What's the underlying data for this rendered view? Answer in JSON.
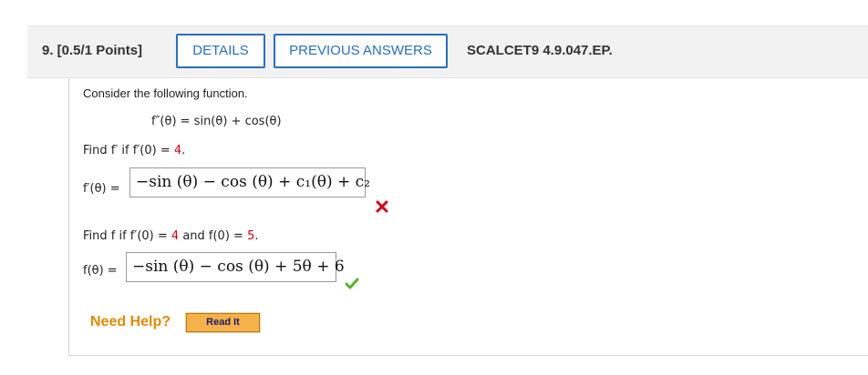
{
  "header": {
    "question_label": "9. [0.5/1 Points]",
    "details_button": "DETAILS",
    "previous_answers_button": "PREVIOUS ANSWERS",
    "problem_id": "SCALCET9 4.9.047.EP."
  },
  "problem": {
    "intro": "Consider the following function.",
    "function": "f″(θ) = sin(θ) + cos(θ)",
    "part1": {
      "prompt_prefix": "Find f′ if f′(0) = ",
      "prompt_value": "4",
      "prompt_suffix": ".",
      "answer_label": "f′(θ) =",
      "answer_value": "−sin (θ) − cos (θ) + c₁(θ) + c₂",
      "status": "incorrect",
      "status_icon": "x-icon",
      "status_color": "#d0021b"
    },
    "part2": {
      "prompt_a": "Find f if f′(0) = ",
      "prompt_value1": "4",
      "prompt_b": " and f(0) = ",
      "prompt_value2": "5",
      "prompt_suffix": ".",
      "answer_label": "f(θ) =",
      "answer_value": "−sin (θ) − cos (θ) + 5θ + 6",
      "status": "correct",
      "status_icon": "checkmark-icon",
      "status_color": "#5ab030"
    }
  },
  "help": {
    "label": "Need Help?",
    "read_it_button": "Read It"
  },
  "colors": {
    "accent": "#2a6ebb",
    "help": "#e08a00",
    "highlight_value": "#d0021b"
  }
}
